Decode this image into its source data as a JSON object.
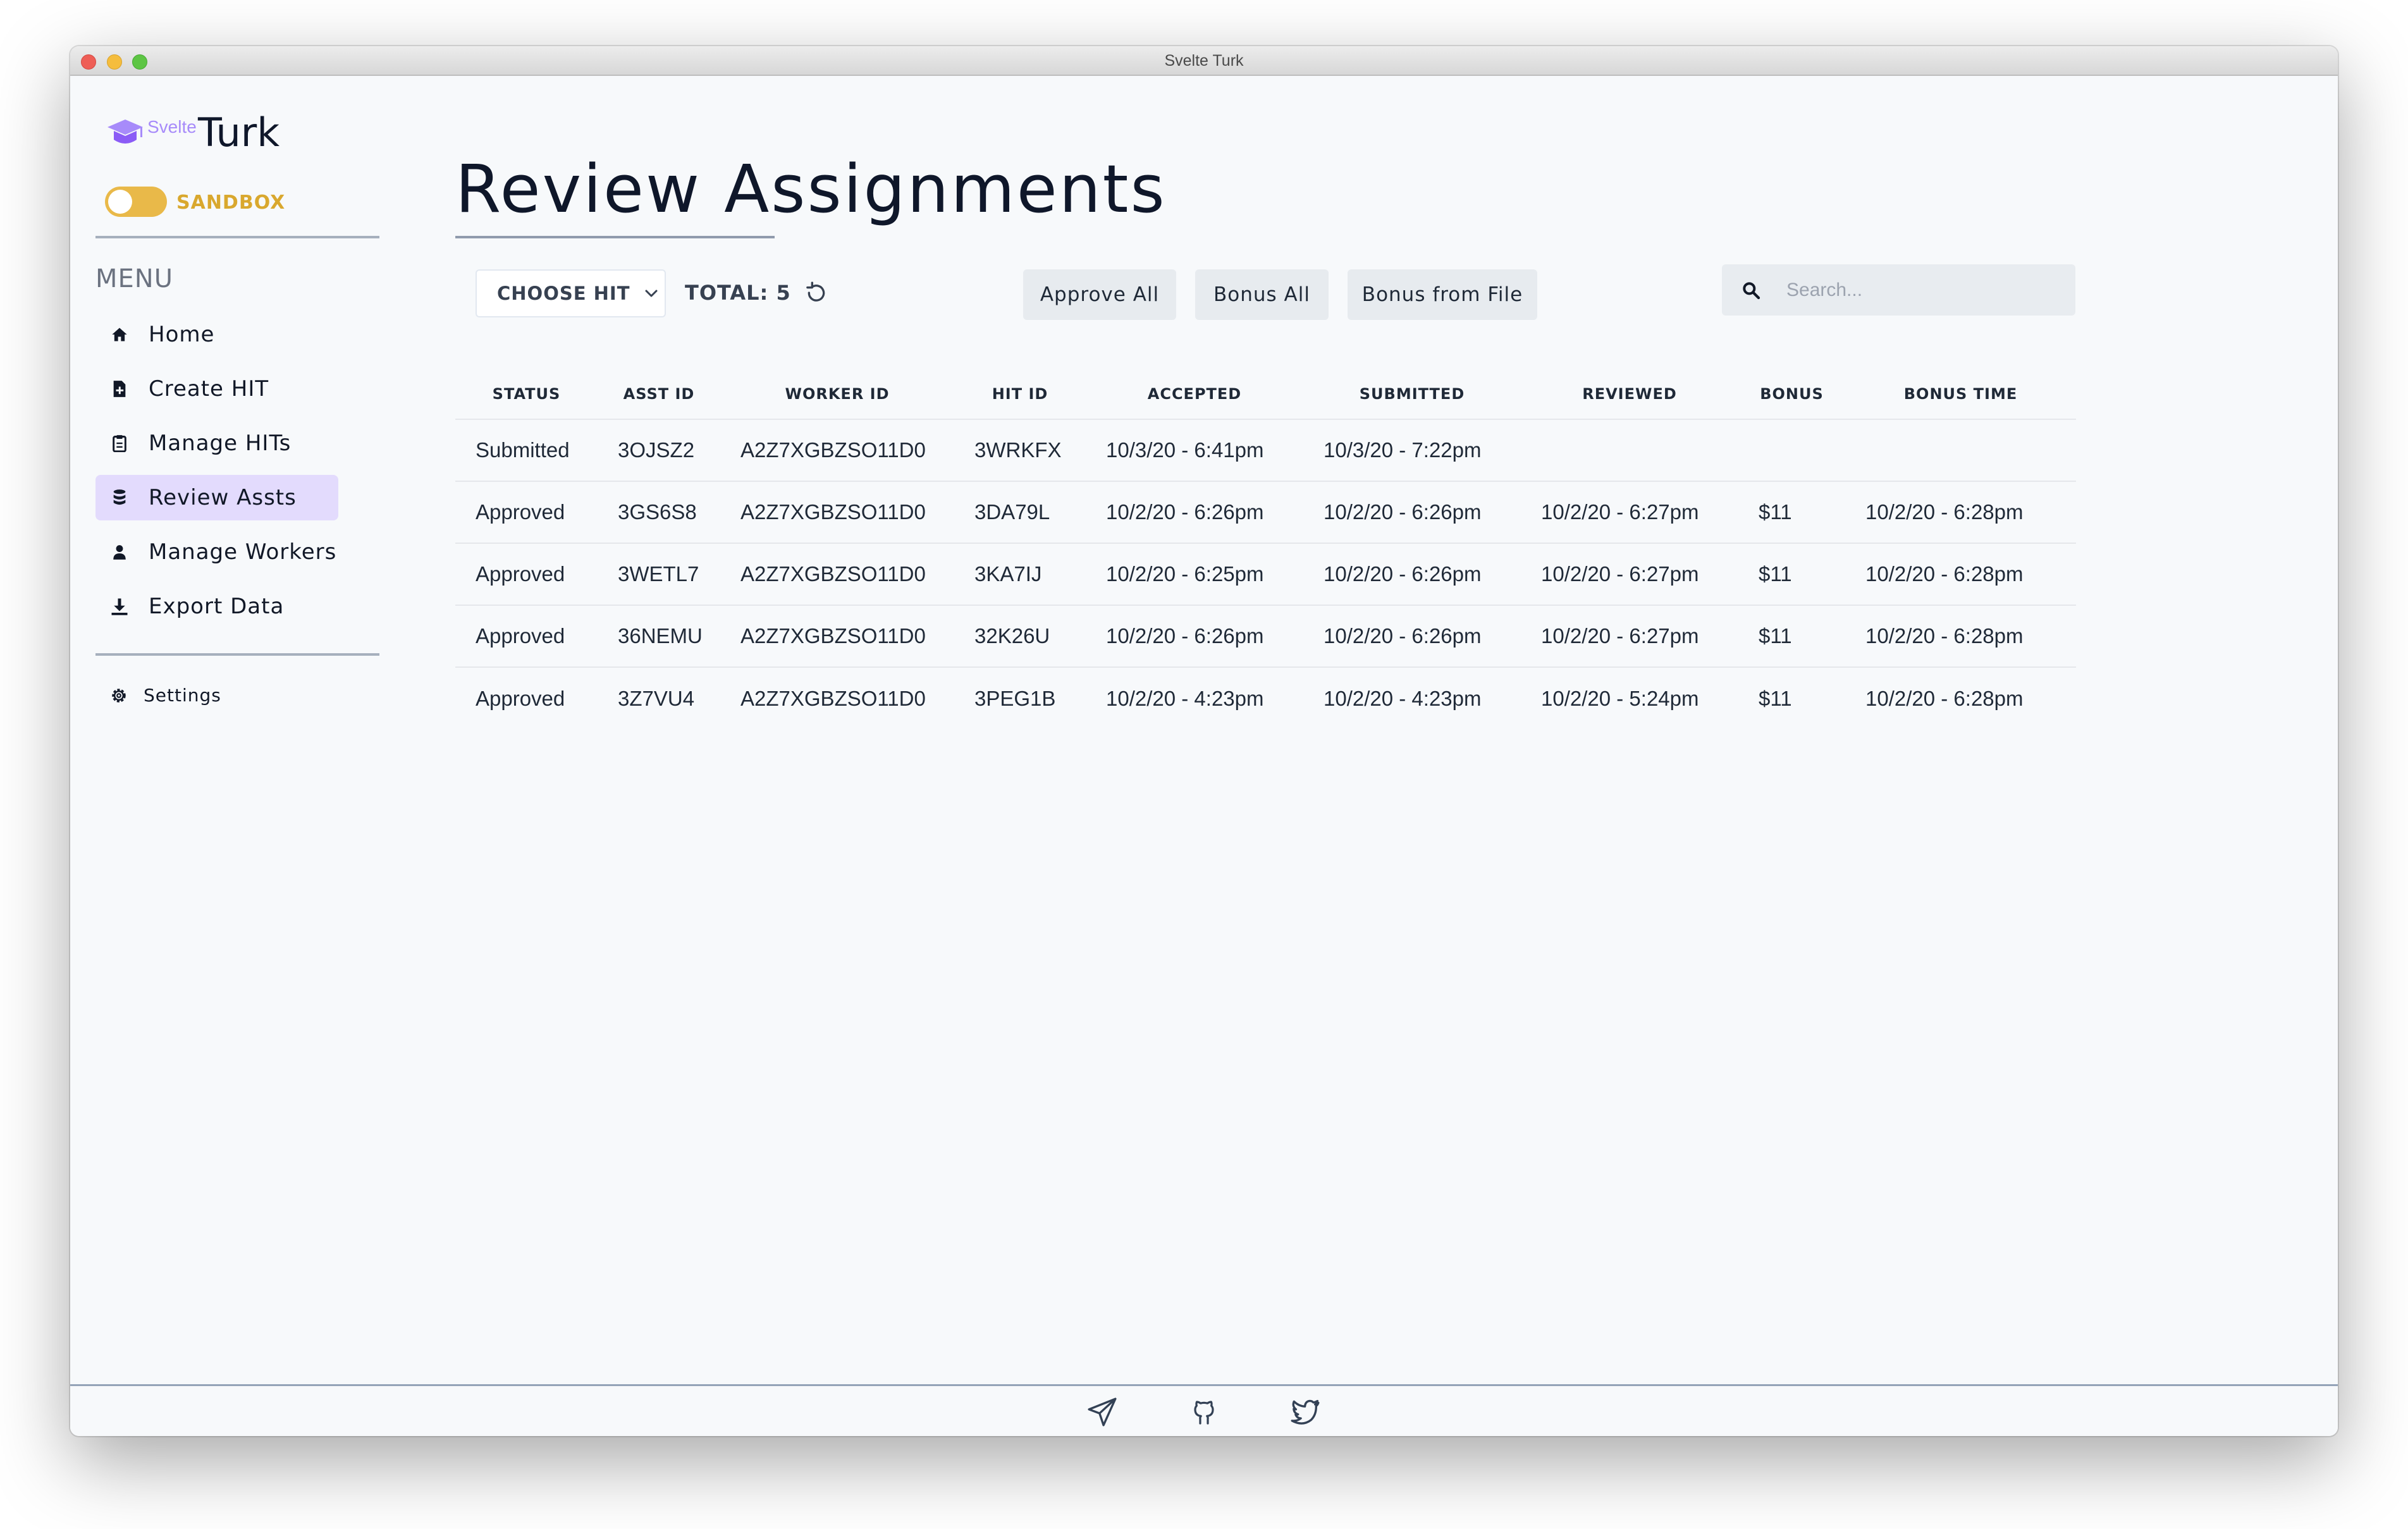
{
  "window": {
    "title": "Svelte Turk"
  },
  "app": {
    "logo_small": "Svelte",
    "logo_big": "Turk"
  },
  "sandbox": {
    "label": "SANDBOX",
    "enabled": true,
    "color": "#e9b949"
  },
  "sidebar": {
    "menu_title": "MENU",
    "items": [
      {
        "label": "Home",
        "icon": "home-icon",
        "active": false
      },
      {
        "label": "Create HIT",
        "icon": "file-plus-icon",
        "active": false
      },
      {
        "label": "Manage HITs",
        "icon": "clipboard-icon",
        "active": false
      },
      {
        "label": "Review Assts",
        "icon": "database-icon",
        "active": true
      },
      {
        "label": "Manage Workers",
        "icon": "user-icon",
        "active": false
      },
      {
        "label": "Export Data",
        "icon": "download-icon",
        "active": false
      }
    ],
    "settings_label": "Settings"
  },
  "page": {
    "title": "Review Assignments"
  },
  "toolbar": {
    "choose_hit_label": "CHOOSE HIT",
    "total_label": "TOTAL: 5",
    "approve_all_label": "Approve All",
    "bonus_all_label": "Bonus All",
    "bonus_file_label": "Bonus from File",
    "search_placeholder": "Search..."
  },
  "table": {
    "columns": [
      "STATUS",
      "ASST ID",
      "WORKER ID",
      "HIT ID",
      "ACCEPTED",
      "SUBMITTED",
      "REVIEWED",
      "BONUS",
      "BONUS TIME"
    ],
    "rows": [
      [
        "Submitted",
        "3OJSZ2",
        "A2Z7XGBZSO11D0",
        "3WRKFX",
        "10/3/20 - 6:41pm",
        "10/3/20 - 7:22pm",
        "",
        "",
        ""
      ],
      [
        "Approved",
        "3GS6S8",
        "A2Z7XGBZSO11D0",
        "3DA79L",
        "10/2/20 - 6:26pm",
        "10/2/20 - 6:26pm",
        "10/2/20 - 6:27pm",
        "$11",
        "10/2/20 - 6:28pm"
      ],
      [
        "Approved",
        "3WETL7",
        "A2Z7XGBZSO11D0",
        "3KA7IJ",
        "10/2/20 - 6:25pm",
        "10/2/20 - 6:26pm",
        "10/2/20 - 6:27pm",
        "$11",
        "10/2/20 - 6:28pm"
      ],
      [
        "Approved",
        "36NEMU",
        "A2Z7XGBZSO11D0",
        "32K26U",
        "10/2/20 - 6:26pm",
        "10/2/20 - 6:26pm",
        "10/2/20 - 6:27pm",
        "$11",
        "10/2/20 - 6:28pm"
      ],
      [
        "Approved",
        "3Z7VU4",
        "A2Z7XGBZSO11D0",
        "3PEG1B",
        "10/2/20 - 4:23pm",
        "10/2/20 - 4:23pm",
        "10/2/20 - 5:24pm",
        "$11",
        "10/2/20 - 6:28pm"
      ]
    ]
  },
  "footer": {
    "icons": [
      "send-icon",
      "github-icon",
      "twitter-icon"
    ]
  }
}
